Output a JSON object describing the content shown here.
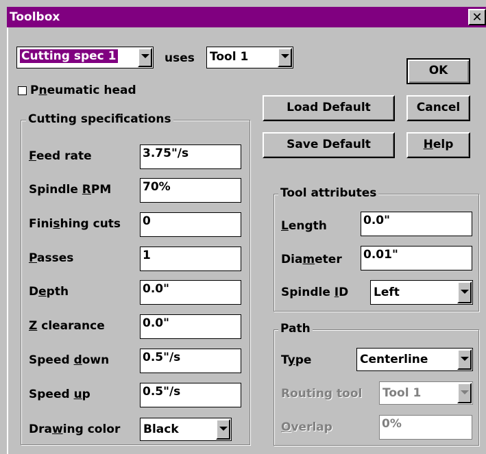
{
  "window": {
    "title": "Toolbox",
    "close_glyph": "✕"
  },
  "top": {
    "cutting_spec": "Cutting spec 1",
    "uses_label": "uses",
    "tool": "Tool 1",
    "pneumatic_pre": "P",
    "pneumatic_ul": "n",
    "pneumatic_post": "eumatic head"
  },
  "buttons": {
    "ok": "OK",
    "load_default": "Load Default",
    "cancel": "Cancel",
    "save_default": "Save Default",
    "help_ul": "H",
    "help_post": "elp"
  },
  "cutting": {
    "title": "Cutting specifications",
    "feed_rate": {
      "pre": "",
      "ul": "F",
      "post": "eed rate",
      "value": "3.75\"/s"
    },
    "spindle_rpm": {
      "pre": "Spindle ",
      "ul": "R",
      "post": "PM",
      "value": "70%"
    },
    "finishing_cuts": {
      "pre": "Fini",
      "ul": "s",
      "post": "hing cuts",
      "value": "0"
    },
    "passes": {
      "pre": "",
      "ul": "P",
      "post": "asses",
      "value": "1"
    },
    "depth": {
      "pre": "D",
      "ul": "e",
      "post": "pth",
      "value": "0.0\""
    },
    "z_clearance": {
      "pre": "",
      "ul": "Z",
      "post": " clearance",
      "value": "0.0\""
    },
    "speed_down": {
      "pre": "Speed ",
      "ul": "d",
      "post": "own",
      "value": "0.5\"/s"
    },
    "speed_up": {
      "pre": "Speed ",
      "ul": "u",
      "post": "p",
      "value": "0.5\"/s"
    },
    "drawing_color": {
      "pre": "Dra",
      "ul": "w",
      "post": "ing color",
      "value": "Black"
    }
  },
  "tool_attributes": {
    "title": "Tool attributes",
    "length": {
      "pre": "",
      "ul": "L",
      "post": "ength",
      "value": "0.0\""
    },
    "diameter": {
      "pre": "Dia",
      "ul": "m",
      "post": "eter",
      "value": "0.01\""
    },
    "spindle_id": {
      "pre": "Spindle ",
      "ul": "I",
      "post": "D",
      "value": "Left"
    }
  },
  "path": {
    "title": "Path",
    "type": {
      "pre": "T",
      "ul": "y",
      "post": "pe",
      "value": "Centerline"
    },
    "routing_tool": {
      "label": "Routing tool",
      "value": "Tool 1"
    },
    "overlap": {
      "pre": "",
      "ul": "O",
      "post": "verlap",
      "value": "0%"
    }
  }
}
